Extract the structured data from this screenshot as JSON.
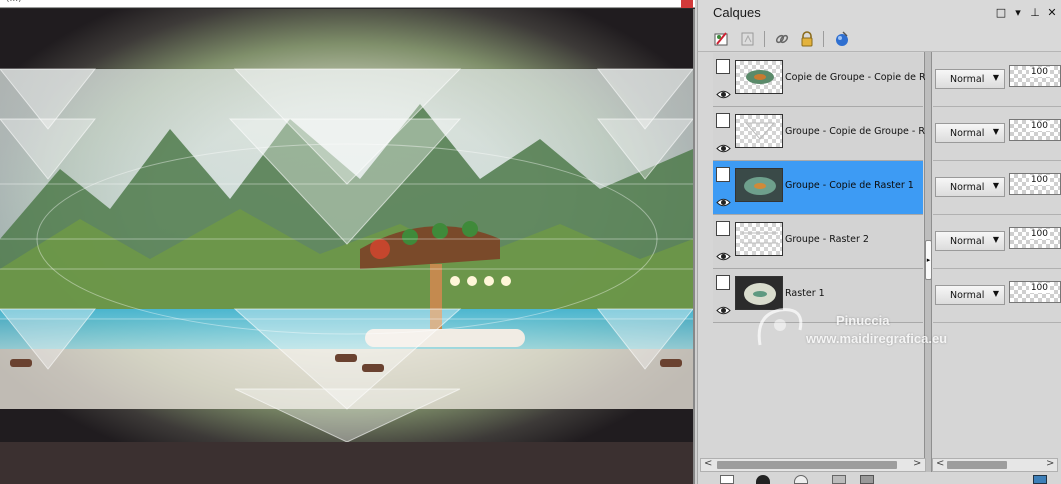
{
  "canvas": {
    "title_fragment": "(...)"
  },
  "palette": {
    "title": "Calques",
    "header_buttons": {
      "restore": "□",
      "menu": "▾",
      "pin": "⊥",
      "close": "✕"
    }
  },
  "layers": [
    {
      "name": "Copie de Groupe - Copie de Raste",
      "blend": "Normal",
      "opacity": "100",
      "selected": false
    },
    {
      "name": "Groupe - Copie de Groupe - Raste",
      "blend": "Normal",
      "opacity": "100",
      "selected": false
    },
    {
      "name": "Groupe - Copie de Raster 1",
      "blend": "Normal",
      "opacity": "100",
      "selected": true
    },
    {
      "name": "Groupe - Raster 2",
      "blend": "Normal",
      "opacity": "100",
      "selected": false
    },
    {
      "name": "Raster 1",
      "blend": "Normal",
      "opacity": "100",
      "selected": false
    }
  ],
  "watermark": {
    "line1": "Pinuccia",
    "line2": "www.maidiregrafica.eu"
  },
  "colors": {
    "selection": "#3d9bf4",
    "panel": "#d6d6d6"
  }
}
